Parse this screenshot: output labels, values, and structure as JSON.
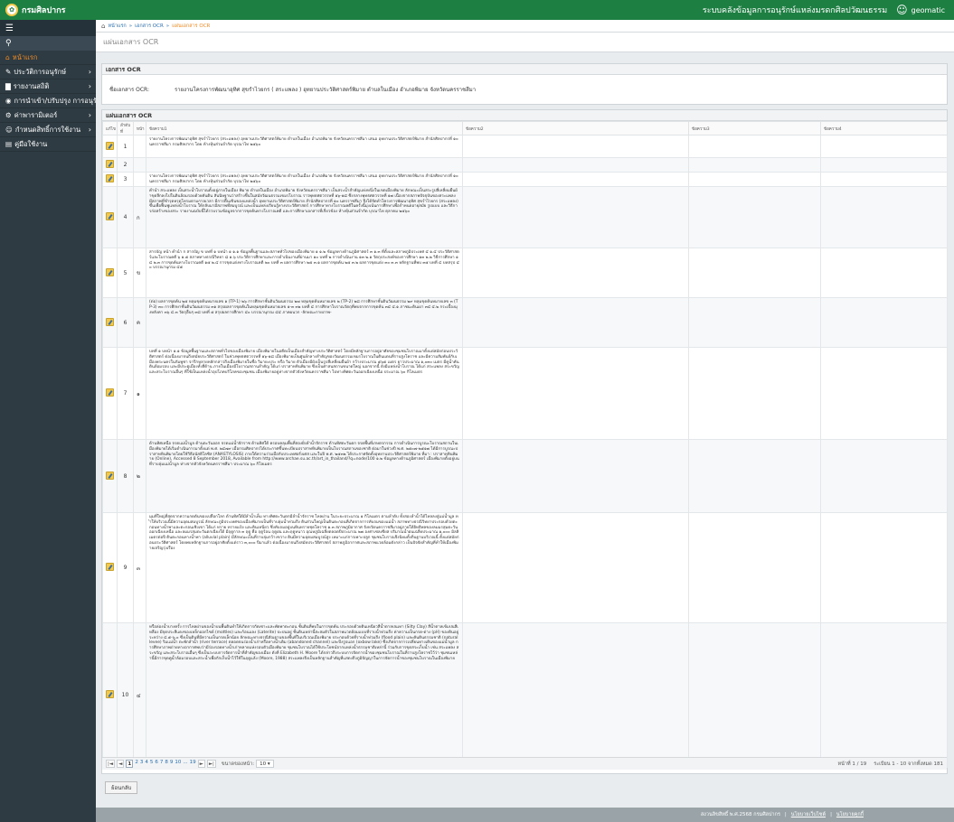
{
  "topbar": {
    "brand": "กรมศิลปากร",
    "system_title": "ระบบคลังข้อมูลการอนุรักษ์แหล่งมรดกศิลปวัฒนธรรม",
    "user": "geomatic"
  },
  "sidebar": {
    "items": [
      {
        "label": "หน้าแรก",
        "icon": "home-icon",
        "active": true
      },
      {
        "label": "ประวัติการอนุรักษ์",
        "icon": "edit-icon",
        "chevron": true
      },
      {
        "label": "รายงานสถิติ",
        "icon": "chart-icon",
        "chevron": true
      },
      {
        "label": "การนำเข้า/ปรับปรุง การอนุรักษ์",
        "icon": "globe-icon",
        "chevron": true
      },
      {
        "label": "ค่าพารามิเตอร์",
        "icon": "gear-icon",
        "chevron": true
      },
      {
        "label": "กำหนดสิทธิ์การใช้งาน",
        "icon": "user-icon",
        "chevron": true
      },
      {
        "label": "คู่มือใช้งาน",
        "icon": "book-icon"
      }
    ]
  },
  "breadcrumb": {
    "home": "หน้าแรก",
    "sep1": "»",
    "level1": "เอกสาร OCR",
    "sep2": "»",
    "current": "แผ่นเอกสาร OCR"
  },
  "page_title": "แผ่นเอกสาร OCR",
  "doc_panel": {
    "title": "เอกสาร OCR",
    "label": "ชื่อเอกสาร OCR:",
    "value": "รายงานโครงการพัฒนาอุทิศ สุขรำไวยกร ( สระแพลง ) อุทยานประวัติศาสตร์พิมาย ตำบลในเมือง อำเภอพิมาย จังหวัดนครราชสีมา"
  },
  "sheet_panel": {
    "title": "แผ่นเอกสาร OCR",
    "columns": [
      "แก้ไข",
      "ลำดับที่",
      "หน้า",
      "ข้อความ1",
      "ข้อความ2",
      "ข้อความ3",
      "ข้อความ4"
    ],
    "rows": [
      {
        "no": "1",
        "page": "",
        "text": "รายงานโครงการพัฒนาอุทิศ สุขรำไวยกร (สระแพลง) อุทยานประวัติศาสตร์พิมาย ตำบลในเมือง อำเภอพิมาย จังหวัดนครราชสีมา เสนอ อุทยานประวัติศาสตร์พิมาย สำนักศิลปากรที่ ๑๐ นครราชสีมา กรมศิลปากร โดย ห้างหุ้นส่วนจำกัด บุรณาไท ๒๕๖๐"
      },
      {
        "no": "2",
        "page": "",
        "text": ""
      },
      {
        "no": "3",
        "page": "",
        "text": "รายงานโครงการพัฒนาอุทิศ สุขรำไวยกร (สระแพลง) อุทยานประวัติศาสตร์พิมาย ตำบลในเมือง อำเภอพิมาย จังหวัดนครราชสีมา เสนอ อุทยานประวัติศาสตร์พิมาย สำนักศิลปากรที่ ๑๐ นครราชสีมา กรมศิลปากร โดย ห้างหุ้นส่วนจำกัด บุรณาไท ๒๕๖๐"
      },
      {
        "no": "4",
        "page": "ก",
        "text": "คำนำ สระแพลง เป็นสระน้ำโบราณตั้งอยู่ภายในเมือง พิมาย ตำบลในเมือง อำเภอพิมาย จังหวัดนครราชสีมา เป็นสระน้ำสำคัญแห่งหนึ่งในเขตเมืองพิมาย ลักษณะเป็นสระรูปสี่เหลี่ยมผืนผ้าขุดลึกลงไปในดินล้อมรอบด้วยคันดิน สันนิษฐานว่าสร้างขึ้นในสมัยวัฒนธรรมเขมรโบราณ ราวพุทธศตวรรษที่ ๑๖-๑๘ ซึ่งกลางพุทธศตวรรษที่ ๑๗ เนื่องจากสภาพปัจจุบันของสระแพลง มีสภาพที่ชำรุดทรุดโทรมตามกาลเวลา มีการตื้นเขินของแหล่งน้ำ อุทยานประวัติศาสตร์พิมาย สำนักศิลปากรที่ ๑๐ นครราชสีมา จึงได้จัดทำโครงการพัฒนาอุทิศ สุขรำไวยกร (สระแพลง) ขึ้นเพื่อฟื้นฟูแหล่งน้ำโบราณ ให้กลับมามีสภาพที่สมบูรณ์ และเป็นแหล่งเรียนรู้ทางประวัติศาสตร์ การศึกษาทางโบราณคดีในครั้งนี้มุ่งเน้นการศึกษาเพื่อกำหนดอายุสมัย รูปแบบ และวิธีการก่อสร้างของสระ รายงานฉบับนี้ได้รวบรวมข้อมูลจากการขุดค้นทางโบราณคดี และการศึกษาเอกสารที่เกี่ยวข้อง ห้างหุ้นส่วนจำกัด บุรณาไท ตุลาคม ๒๕๖๐"
      },
      {
        "no": "5",
        "page": "ข",
        "text": "สารบัญ หน้า คำนำ ก สารบัญ ข บทที่ ๑ บทนำ ๑ ๑.๑ ข้อมูลพื้นฐานและสภาพทั่วไปของเมืองพิมาย ๑ ๑.๒ ข้อมูลทางด้านภูมิศาสตร์ ๓ ๑.๓ ที่ตั้งและสภาพภูมิประเทศ ๔ ๑.๔ ประวัติศาสตร์และโบราณคดี ๖ ๑.๕ สภาพทางธรณีวิทยา ๘ ๑.๖ ประวัติการศึกษาและการดำเนินงานที่ผ่านมา ๑๐ บทที่ ๒ การดำเนินงาน ๑๓ ๒.๑ วัตถุประสงค์ของการศึกษา ๑๓ ๒.๒ วิธีการศึกษา ๑๔ ๒.๓ การขุดค้นทางโบราณคดี ๑๕ ๒.๔ การขุดแต่งทางโบราณคดี ๒๐ บทที่ ๓ ผลการศึกษา ๒๕ ๓.๑ ผลการขุดค้น ๒๕ ๓.๒ ผลการขุดแต่ง ๓๐ ๓.๓ หลักฐานที่พบ ๓๕ บทที่ ๔ บทสรุป ๔๐ บรรณานุกรม ๔๕"
      },
      {
        "no": "6",
        "page": "ค",
        "text": "(ต่อ) ผลการขุดค้น ๒๕ หลุมขุดค้นหมายเลข ๑ (TP-1) ๒๖ การศึกษาชั้นดินวัฒนธรรม ๒๗ หลุมขุดค้นหมายเลข ๒ (TP-2) ๒๘ การศึกษาชั้นดินวัฒนธรรม ๒๙ หลุมขุดค้นหมายเลข ๓ (TP-3) ๓๐ การศึกษาชั้นดินวัฒนธรรม ๓๑ สรุปผลการขุดค้นในหลุมขุดค้นหมายเลข ๑-๓ ๓๒ บทที่ ๔ การศึกษาโบราณวัตถุที่พบจากการขุดค้น ๓๔ ๔.๑ ภาชนะดินเผา ๓๔ ๔.๒ กระเบื้องมุงหลังคา ๓๖ ๔.๓ วัตถุอื่นๆ ๓๘ บทที่ ๕ สรุปผลการศึกษา ๔๐ บรรณานุกรม ๔๔ ภาคผนวก -ลักษณะกายภาพ-"
      },
      {
        "no": "7",
        "page": "๑",
        "text": "บทที่ ๑ บทนำ ๑.๑ ข้อมูลพื้นฐานและสภาพทั่วไปของเมืองพิมาย เมืองพิมายในอดีตเป็นเมืองสำคัญทางประวัติศาสตร์ โดยมีหลักฐานการอยู่อาศัยของชุมชนโบราณมาตั้งแต่สมัยก่อนประวัติศาสตร์ ต่อเนื่องมาจนถึงสมัยประวัติศาสตร์ ในช่วงพุทธศตวรรษที่ ๑๖-๑๘ เมืองพิมายเป็นศูนย์กลางสำคัญของวัฒนธรรมเขมรโบราณในดินแดนที่ราบสูงโคราช และมีความสัมพันธ์กับเมืองพระนครในกัมพูชา จารึกหลายหลักกล่าวถึงเมืองพิมายในชื่อ วิมายะปุระ หรือ วิมาย ตัวเมืองมีผังเป็นรูปสี่เหลี่ยมผืนผ้า กว้างประมาณ ๕๖๕ เมตร ยาวประมาณ ๑,๐๓๐ เมตร มีคูน้ำคันดินล้อมรอบ และมีประตูเมืองทั้งสี่ด้าน ภายในเมืองมีโบราณสถานสำคัญ ได้แก่ ปราสาทหินพิมาย ซึ่งเป็นศาสนสถานขนาดใหญ่ นอกจากนี้ ยังมีแหล่งน้ำโบราณ ได้แก่ สระแพลง สระขวัญ และสระโบราณอื่นๆ ที่ใช้เป็นแหล่งน้ำอุปโภคบริโภคของชุมชน เมืองพิมายอยู่ห่างจากตัวจังหวัดนครราชสีมา ไปทางทิศตะวันออกเฉียงเหนือ ประมาณ ๖๐ กิโลเมตร"
      },
      {
        "no": "8",
        "page": "๒",
        "text": "ด้านทิศเหนือ จรดแม่น้ำมูล ด้านตะวันออก จรดแม่น้ำจักราช ด้านทิศใต้ ครอบคลุมพื้นที่สองฝั่งลำน้ำจักราช ด้านทิศตะวันตก จรดพื้นที่เกษตรกรรม การดำเนินการบูรณะโบราณสถานในเมืองพิมายได้เริ่มดำเนินการมาตั้งแต่ พ.ศ. ๒๔๗๙ เมื่อกรมศิลปากรได้ประกาศขึ้นทะเบียนปราสาทหินพิมายเป็นโบราณสถานของชาติ ต่อมาในช่วงปี พ.ศ. ๒๕๐๗-๒๕๑๗ ได้มีการบูรณะปราสาทหินพิมายโดยใช้วิธีอนัสติโลซิส (ANASTYLOSIS) ภายใต้ความร่วมมือกับประเทศฝรั่งเศส และในปี พ.ศ. ๒๕๓๒ ได้ประกาศจัดตั้งอุทยานประวัติศาสตร์พิมาย ที่มา : ปราสาทหินพิมาย (Online), Accessed 8 September 2018, Available from http://www.archae.su.ac.th/art_in_thailand/?q=node/100 ๑.๒ ข้อมูลทางด้านภูมิศาสตร์ เมืองพิมายตั้งอยู่บนที่ราบลุ่มแม่น้ำมูล ห่างจากตัวจังหวัดนครราชสีมา ประมาณ ๖๐ กิโลเมตร"
      },
      {
        "no": "9",
        "page": "๓",
        "text": "มุมที่ใหญ่ที่สุดจากความกดดันของเปลือกโลก ด้านทิศใต้มีลำน้ำเค็ม ทางทิศตะวันตกมีลำน้ำจักราช ไหลผ่าน ในระยะประมาณ ๑ กิโลเมตร ตามลำดับ ทั้งสองลำน้ำได้ไหลลงสู่แม่น้ำมูล ทำให้บริเวณนี้มีความอุดมสมบูรณ์ ลักษณะภูมิประเทศของเมืองพิมายเป็นที่ราบลุ่มน้ำท่วมถึง ดินส่วนใหญ่เป็นดินตะกอนที่เกิดจากการทับถมของแม่น้ำ สภาพทางธรณีวิทยาประกอบด้วยตะกอนทางน้ำพาและตะกอนเชิงเขา ได้แก่ ทราย ทรายแป้ง และดินเหนียว ซึ่งทับถมอยู่บนหินทรายชุดโคราช ๑.๓ สภาพภูมิอากาศ จังหวัดนครราชสีมาอยู่ภายใต้อิทธิพลของลมมรสุมตะวันออกเฉียงเหนือ และลมมรสุมตะวันตกเฉียงใต้ มีฤดูกาล ๓ ฤดู คือ ฤดูร้อน ฤดูฝน และฤดูหนาว อุณหภูมิเฉลี่ยตลอดปีประมาณ ๒๗ องศาเซลเซียส ปริมาณน้ำฝนเฉลี่ยประมาณ ๑,๐๐๐ มิลลิเมตรต่อปี ดินตะกอนทางน้ำพา (alluvial plain) มีลักษณะเป็นที่ราบลุ่มกว้างขวาง ดินมีความอุดมสมบูรณ์สูง เหมาะแก่การเพาะปลูก ชุมชนโบราณจึงนิยมตั้งถิ่นฐานบริเวณนี้ ตั้งแต่สมัยก่อนประวัติศาสตร์ โดยพบหลักฐานการอยู่อาศัยตั้งแต่ราว ๓,๐๐๐ ปีมาแล้ว ต่อเนื่องมาจนถึงสมัยประวัติศาสตร์ สภาพภูมิอากาศและสภาพแวดล้อมดังกล่าว เป็นปัจจัยสำคัญที่ทำให้เมืองพิมายเจริญรุ่งเรือง"
      },
      {
        "no": "10",
        "page": "๔",
        "text": "หรือล่องน้ำบางครั้ง การไหลผ่านของน้ำบนพื้นดินทำให้เกิดการกัดเซาะและพัดพาตะกอน ชั้นดินที่พบในการขุดค้น ประกอบด้วยดินเหนียวสีน้ำตาลปนเทา (Silty Clay) สีน้ำตาลเข้มปนสีเหลือง มีจุดประสีแดงของเหล็กออกไซด์ (mottles) และก้อนแลง (Laterite) ปะปนอยู่ ชั้นดินเหล่านี้สะสมตัวในสภาพแวดล้อมแบบที่ราบน้ำท่วมถึง ค่าความเป็นกรด-ด่าง (pH) ของดินอยู่ระหว่าง ๔.๕-๖.๐ ซึ่งเป็นดินที่มีความเป็นกรดเล็กน้อย ลักษณะทางธรณีสัณฐานของพื้นที่ในบริเวณเมืองพิมาย ประกอบด้วยที่ราบน้ำท่วมถึง (flood plain) และคันดินธรรมชาติ (natural levee) ริมแม่น้ำ ตะพักลำน้ำ (river terrace) ตลอดจนร่องน้ำเก่าหรือทางน้ำเดิม (abandoned channel) และบึงรูปแอก (oxbow lake) ซึ่งเกิดจากการเปลี่ยนทางเดินของแม่น้ำมูล การศึกษาภาพถ่ายทางอากาศพบว่ามีร่องรอยทางน้ำเก่าหลายแห่งรอบตัวเมืองพิมาย ชุมชนโบราณได้ใช้ประโยชน์จากแหล่งน้ำธรรมชาติเหล่านี้ ร่วมกับการขุดสระเก็บน้ำ เช่น สระแพลง สระขวัญ และสระโบราณอื่นๆ ซึ่งเป็นระบบการจัดการน้ำที่สำคัญของเมือง ดังที่ Elizabeth H. Moore ได้กล่าวถึงระบบการจัดการน้ำของชุมชนโบราณในที่ราบสูงโคราชไว้ว่า ชุมชนเหล่านี้มีการขุดคูน้ำล้อมรอบและสระน้ำเพื่อกักเก็บน้ำไว้ใช้ในฤดูแล้ง (Moore, 1988) สระแพลงจึงเป็นหลักฐานสำคัญที่แสดงถึงภูมิปัญญาในการจัดการน้ำของชุมชนโบราณในเมืองพิมาย"
      }
    ],
    "pager": {
      "first": "|◄",
      "prev": "◄",
      "pages": [
        "1",
        "2",
        "3",
        "4",
        "5",
        "6",
        "7",
        "8",
        "9",
        "10",
        "...",
        "19"
      ],
      "next": "►",
      "last": "►|",
      "size_label": "ขนาดของหน้า:",
      "size_value": "10",
      "page_info": "หน้าที่ 1 / 19",
      "record_info": "ระเบียน 1 - 10 จากทั้งหมด 181"
    }
  },
  "back_button": "ย้อนกลับ",
  "footer": {
    "copyright": "สงวนลิขสิทธิ์ พ.ศ.2568 กรมศิลปากร",
    "link1": "นโยบายเว็บไซต์",
    "link2": "นโยบายคุกกี้"
  },
  "colors": {
    "topbar": "#1e7f43",
    "sidebar": "#2e3b43",
    "accent": "#f08a24",
    "link": "#2a6fb0"
  }
}
